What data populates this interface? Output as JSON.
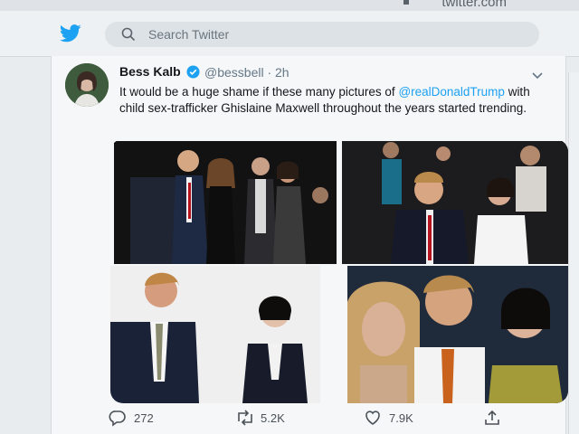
{
  "browser": {
    "url": "twitter.com"
  },
  "header": {
    "search_placeholder": "Search Twitter"
  },
  "tweet": {
    "author_name": "Bess Kalb",
    "author_handle": "@bessbell",
    "time": "· 2h",
    "text_before": "It would be a huge shame if these many pictures of ",
    "mention": "@realDonaldTrump",
    "text_after": " with child sex-trafficker Ghislaine Maxwell throughout the years started trending.",
    "stats": {
      "replies": "272",
      "retweets": "5.2K",
      "likes": "7.9K"
    }
  },
  "colors": {
    "accent": "#1da1f2",
    "text": "#14171a",
    "muted": "#657786"
  },
  "icons": [
    "twitter-bird-icon",
    "search-icon",
    "verified-icon",
    "chevron-down-icon",
    "reply-icon",
    "retweet-icon",
    "heart-icon",
    "share-icon"
  ]
}
